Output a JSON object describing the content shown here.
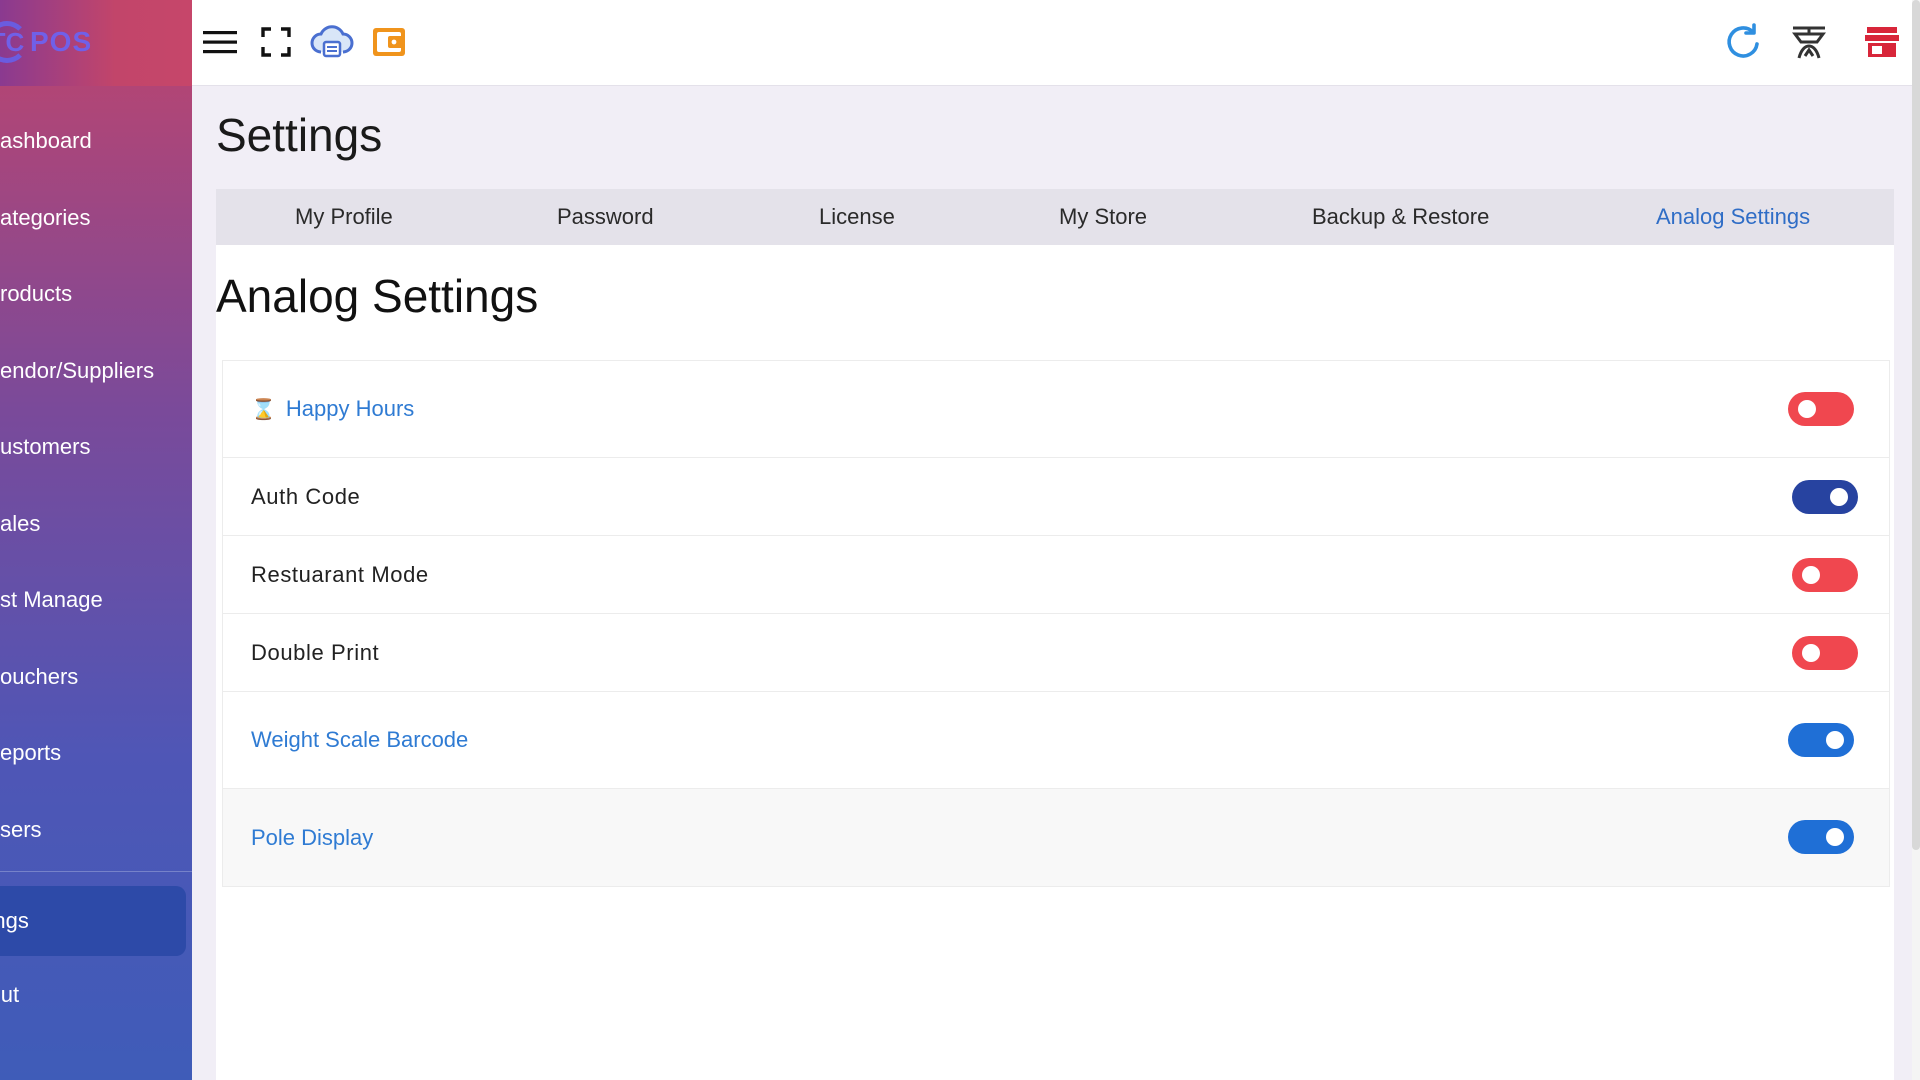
{
  "app": {
    "logo_text": "POS",
    "logo_mark": "TC"
  },
  "sidebar": {
    "items": [
      {
        "label": "ashboard"
      },
      {
        "label": "ategories"
      },
      {
        "label": "roducts"
      },
      {
        "label": "endor/Suppliers"
      },
      {
        "label": "ustomers"
      },
      {
        "label": "ales"
      },
      {
        "label": "st Manage"
      },
      {
        "label": "ouchers"
      },
      {
        "label": "eports"
      },
      {
        "label": "sers"
      }
    ],
    "active": {
      "label": "ettings"
    },
    "logout": {
      "label": "ogout"
    }
  },
  "topbar": {
    "icons": [
      "menu-icon",
      "fullscreen-icon",
      "cloud-printer-icon",
      "wallet-icon",
      "refresh-icon",
      "scale-icon",
      "store-icon"
    ],
    "colors": {
      "cloud": "#4a6fd0",
      "wallet": "#f0941c",
      "refresh": "#2f8fe0",
      "store": "#d8263a"
    }
  },
  "page": {
    "title": "Settings"
  },
  "tabs": [
    {
      "label": "My Profile"
    },
    {
      "label": "Password"
    },
    {
      "label": "License"
    },
    {
      "label": "My Store"
    },
    {
      "label": "Backup & Restore"
    },
    {
      "label": "Analog Settings",
      "active": true
    }
  ],
  "section": {
    "title": "Analog Settings"
  },
  "settings": [
    {
      "label": "Happy Hours",
      "icon": "hourglass-icon",
      "enabled": false,
      "color": "#f0474f"
    },
    {
      "label": "Auth Code",
      "enabled": true,
      "color": "#2743a0"
    },
    {
      "label": "Restuarant Mode",
      "enabled": false,
      "color": "#f0474f"
    },
    {
      "label": "Double Print",
      "enabled": false,
      "color": "#f0474f"
    },
    {
      "label": "Weight Scale Barcode",
      "enabled": true,
      "color": "#1f6fd6"
    },
    {
      "label": "Pole Display",
      "enabled": true,
      "color": "#1f6fd6"
    }
  ]
}
